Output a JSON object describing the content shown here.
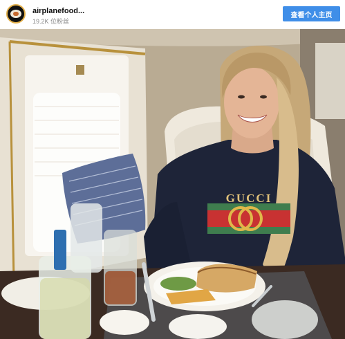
{
  "header": {
    "username": "airplanefood...",
    "followers": "19.2K 位粉丝",
    "visit_button": "查看个人主页"
  },
  "photo": {
    "shirt_logo_text": "GUCCI"
  }
}
